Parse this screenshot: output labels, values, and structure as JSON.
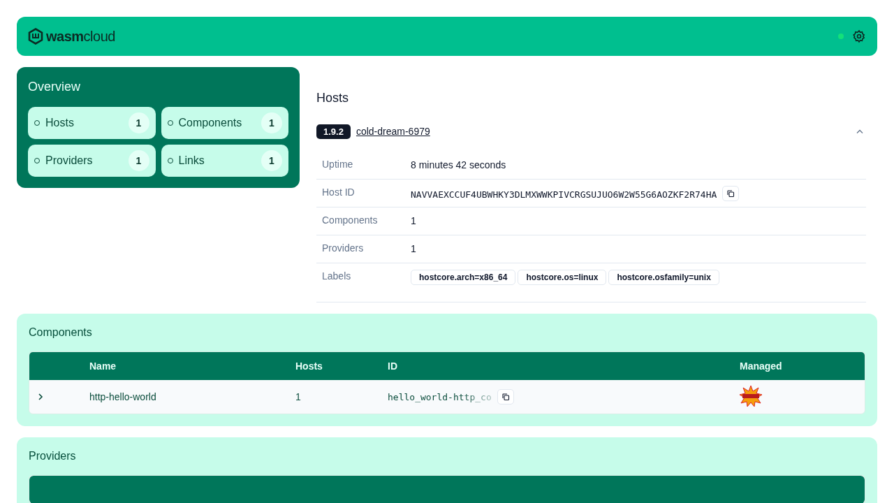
{
  "header": {
    "logo": "**wasm**cloud",
    "connected": true
  },
  "overview": {
    "title": "Overview",
    "items": [
      {
        "label": "Hosts",
        "count": "1"
      },
      {
        "label": "Components",
        "count": "1"
      },
      {
        "label": "Providers",
        "count": "1"
      },
      {
        "label": "Links",
        "count": "1"
      }
    ]
  },
  "hosts": {
    "title": "Hosts",
    "host": {
      "version": "1.9.2",
      "name": "cold-dream-6979",
      "expanded": true,
      "details": [
        {
          "kind": "text",
          "label": "Uptime",
          "value": "8 minutes 42 seconds"
        },
        {
          "kind": "id",
          "label": "Host ID",
          "value": "NAVVAEXCCUF4UBWHKY3DLMXWWKPIVCRGSUJUO6W2W55G6AOZKF2R74HA"
        },
        {
          "kind": "text",
          "label": "Components",
          "value": "1"
        },
        {
          "kind": "text",
          "label": "Providers",
          "value": "1"
        },
        {
          "kind": "tags",
          "label": "Labels",
          "tags": [
            "hostcore.arch=x86_64",
            "hostcore.os=linux",
            "hostcore.osfamily=unix"
          ]
        }
      ]
    }
  },
  "components": {
    "title": "Components",
    "columns": [
      "Name",
      "Hosts",
      "ID",
      "Managed"
    ],
    "rows": [
      {
        "expanded": false,
        "name": "http-hello-world",
        "hosts": "1",
        "id": "hello_world-http_co",
        "managed": true
      }
    ]
  },
  "providers": {
    "title": "Providers"
  }
}
